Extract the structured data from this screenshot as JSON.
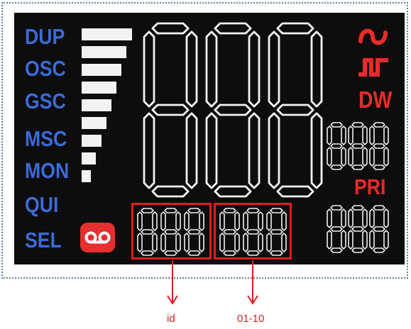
{
  "panel": {
    "labels": [
      {
        "text": "DUP",
        "color": "#3b6bd8"
      },
      {
        "text": "OSC",
        "color": "#3b6bd8"
      },
      {
        "text": "GSC",
        "color": "#3b6bd8"
      },
      {
        "text": "MSC",
        "color": "#3b6bd8"
      },
      {
        "text": "MON",
        "color": "#3b6bd8"
      },
      {
        "text": "QUI",
        "color": "#3b6bd8"
      },
      {
        "text": "SEL",
        "color": "#3b6bd8"
      }
    ],
    "right_labels": {
      "dw": "DW",
      "pri": "PRI"
    },
    "signal_bar_count": 9,
    "icons": [
      "sine-wave-icon",
      "square-wave-icon",
      "cassette-tape-icon"
    ],
    "colors": {
      "lcd_background": "#0d0d0d",
      "segment": "#f2f2f2",
      "label_blue": "#3b6bd8",
      "accent_red": "#ea2a2a"
    }
  },
  "displays": {
    "main_digits": 3,
    "right_upper_digits": 3,
    "right_lower_digits": 3,
    "id_field_digits": 3,
    "channel_field_digits": 3
  },
  "annotations": {
    "id_field": "id",
    "channel_field": "01-10"
  }
}
